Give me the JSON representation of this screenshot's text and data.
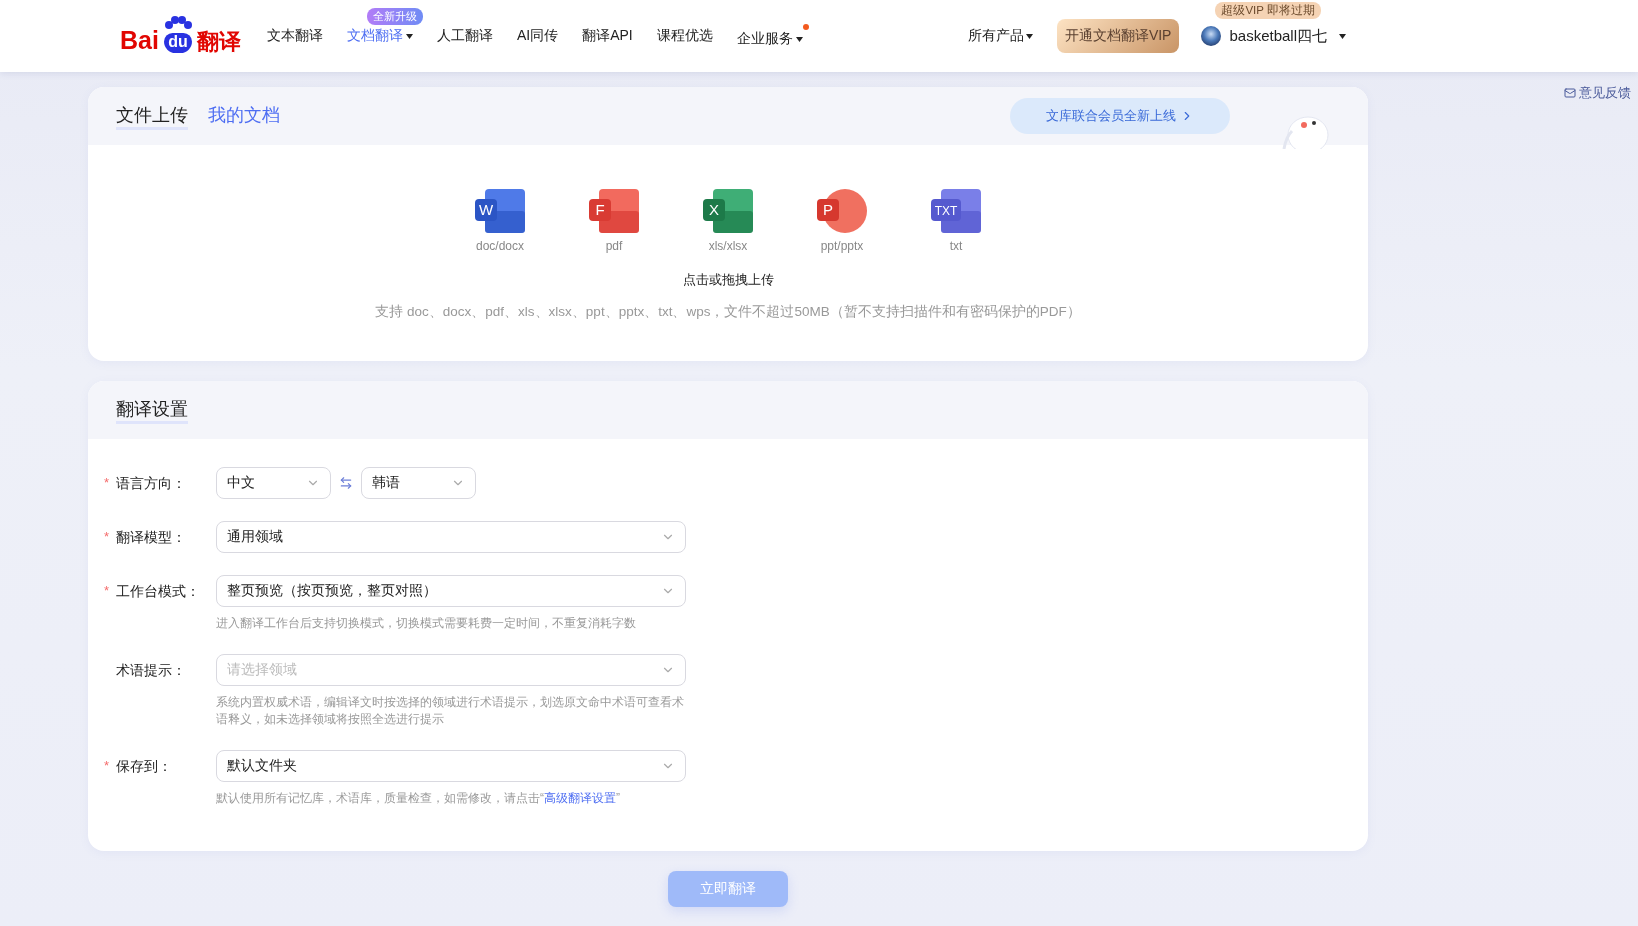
{
  "header": {
    "logo": {
      "text_1": "Bai",
      "text_2": "du",
      "text_3": "翻译"
    },
    "nav": [
      {
        "label": "文本翻译",
        "selected": false,
        "dropdown": false,
        "dot": false
      },
      {
        "label": "文档翻译",
        "selected": true,
        "dropdown": true,
        "dot": false,
        "badge": "全新升级"
      },
      {
        "label": "人工翻译",
        "selected": false,
        "dropdown": false,
        "dot": false
      },
      {
        "label": "AI同传",
        "selected": false,
        "dropdown": false,
        "dot": false
      },
      {
        "label": "翻译API",
        "selected": false,
        "dropdown": false,
        "dot": false
      },
      {
        "label": "课程优选",
        "selected": false,
        "dropdown": false,
        "dot": false
      },
      {
        "label": "企业服务",
        "selected": false,
        "dropdown": true,
        "dot": true
      }
    ],
    "products": "所有产品",
    "vip_button": "开通文档翻译VIP",
    "user": {
      "name": "basketball四七",
      "badge": "超级VIP 即将过期"
    }
  },
  "feedback": "意见反馈",
  "upload": {
    "tabs": [
      {
        "label": "文件上传",
        "selected": true
      },
      {
        "label": "我的文档",
        "selected": false
      }
    ],
    "promo": "文库联合会员全新上线",
    "formats": [
      {
        "kind": "word",
        "glyph": "W",
        "label": "doc/docx"
      },
      {
        "kind": "pdf",
        "glyph": "F",
        "label": "pdf"
      },
      {
        "kind": "excel",
        "glyph": "X",
        "label": "xls/xlsx"
      },
      {
        "kind": "ppt",
        "glyph": "P",
        "label": "ppt/pptx"
      },
      {
        "kind": "txt",
        "glyph": "TXT",
        "label": "txt"
      }
    ],
    "hint": "点击或拖拽上传",
    "note": "支持 doc、docx、pdf、xls、xlsx、ppt、pptx、txt、wps，文件不超过50MB（暂不支持扫描件和有密码保护的PDF）"
  },
  "settings": {
    "title": "翻译设置",
    "fields": [
      {
        "kind": "pair",
        "label": "语言方向：",
        "mark": "*",
        "source": "中文",
        "target": "韩语"
      },
      {
        "kind": "select",
        "label": "翻译模型：",
        "mark": "*",
        "value": "通用领域"
      },
      {
        "kind": "select",
        "label": "工作台模式：",
        "mark": "*",
        "value": "整页预览（按页预览，整页对照）",
        "help": "进入翻译工作台后支持切换模式，切换模式需要耗费一定时间，不重复消耗字数"
      },
      {
        "kind": "select",
        "label": "术语提示：",
        "placeholder": "请选择领域",
        "help": "系统内置权威术语，编辑译文时按选择的领域进行术语提示，划选原文命中术语可查看术语释义，如未选择领域将按照全选进行提示"
      },
      {
        "kind": "select",
        "label": "保存到：",
        "mark": "*",
        "value": "默认文件夹",
        "help": "默认使用所有记忆库，术语库，质量检查，如需修改，请点击“",
        "help_link": "高级翻译设置",
        "help_after": "”"
      }
    ]
  },
  "submit": {
    "label": "立即翻译",
    "disabled": true
  }
}
